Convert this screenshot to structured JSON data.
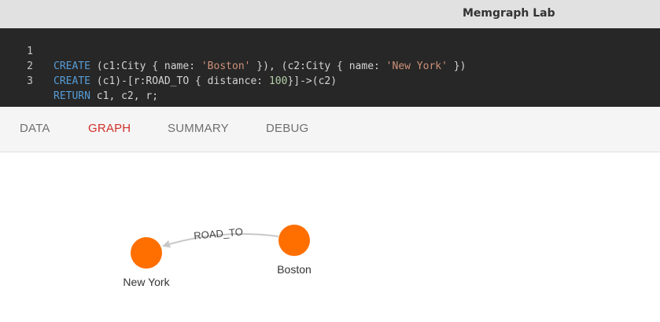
{
  "window": {
    "title": "Memgraph Lab"
  },
  "editor": {
    "lines": [
      {
        "number": "1",
        "segments": [
          {
            "t": "CREATE",
            "c": "kw"
          },
          {
            "t": " (c1:City { name: ",
            "c": "id"
          },
          {
            "t": "'Boston'",
            "c": "str"
          },
          {
            "t": " }), (c2:City { name: ",
            "c": "id"
          },
          {
            "t": "'New York'",
            "c": "str"
          },
          {
            "t": " })",
            "c": "id"
          }
        ]
      },
      {
        "number": "2",
        "segments": [
          {
            "t": "CREATE",
            "c": "kw"
          },
          {
            "t": " (c1)-[r:ROAD_TO { distance: ",
            "c": "id"
          },
          {
            "t": "100",
            "c": "num"
          },
          {
            "t": "}]->(c2)",
            "c": "id"
          }
        ]
      },
      {
        "number": "3",
        "segments": [
          {
            "t": "RETURN",
            "c": "kw"
          },
          {
            "t": " c1, c2, r;",
            "c": "id"
          }
        ]
      }
    ]
  },
  "tabs": {
    "data": "DATA",
    "graph": "GRAPH",
    "summary": "SUMMARY",
    "debug": "DEBUG",
    "active": "graph"
  },
  "graph": {
    "nodes": {
      "new_york": "New York",
      "boston": "Boston"
    },
    "edge_label": "ROAD_TO",
    "node_color": "#ff6f00",
    "edge_color": "#c8c8c8"
  },
  "colors": {
    "active_tab": "#d0302a",
    "editor_bg": "#272727",
    "titlebar_bg": "#e1e1e1"
  }
}
